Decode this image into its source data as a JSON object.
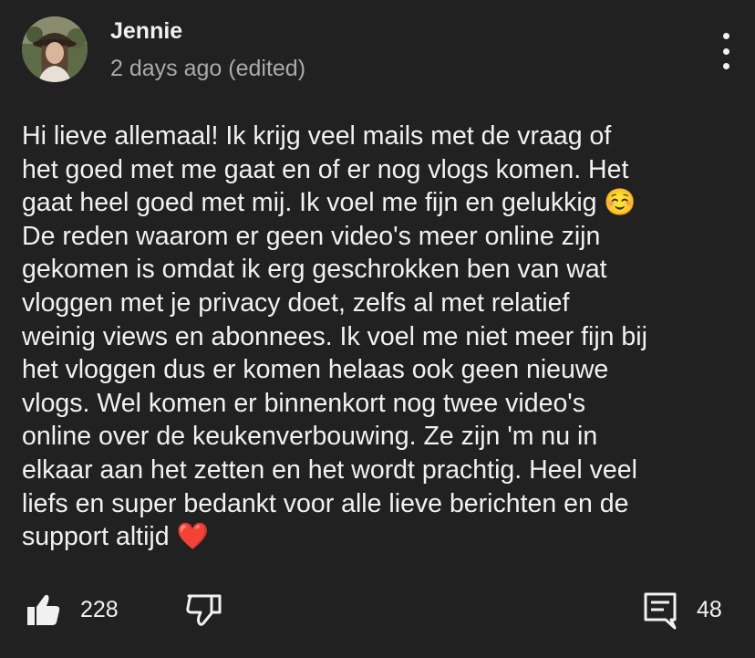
{
  "comment": {
    "author": "Jennie",
    "timestamp": "2 days ago (edited)",
    "text": "Hi lieve allemaal! Ik krijg veel mails met de vraag of\nhet goed met me gaat en of er nog vlogs komen. Het\ngaat heel goed met mij. Ik voel me fijn en gelukkig ☺️\nDe reden waarom er geen video's meer online zijn\ngekomen is omdat ik erg geschrokken ben van wat\nvloggen met je privacy doet, zelfs al met relatief\nweinig views en abonnees. Ik voel me niet meer fijn bij\nhet vloggen dus er komen helaas ook geen nieuwe\nvlogs. Wel komen er binnenkort nog twee video's\nonline over de keukenverbouwing. Ze zijn 'm nu in\nelkaar aan het zetten en het wordt prachtig. Heel veel\nliefs en super bedankt voor alle lieve berichten en de\nsupport altijd ❤️",
    "likes": "228",
    "replies": "48"
  },
  "icons": {
    "menu": "more-vertical-icon",
    "like": "thumbs-up-icon",
    "dislike": "thumbs-down-icon",
    "reply": "comment-reply-icon"
  },
  "colors": {
    "background": "#212121",
    "text": "#f1f1f1",
    "secondary_text": "#aaaaaa"
  }
}
